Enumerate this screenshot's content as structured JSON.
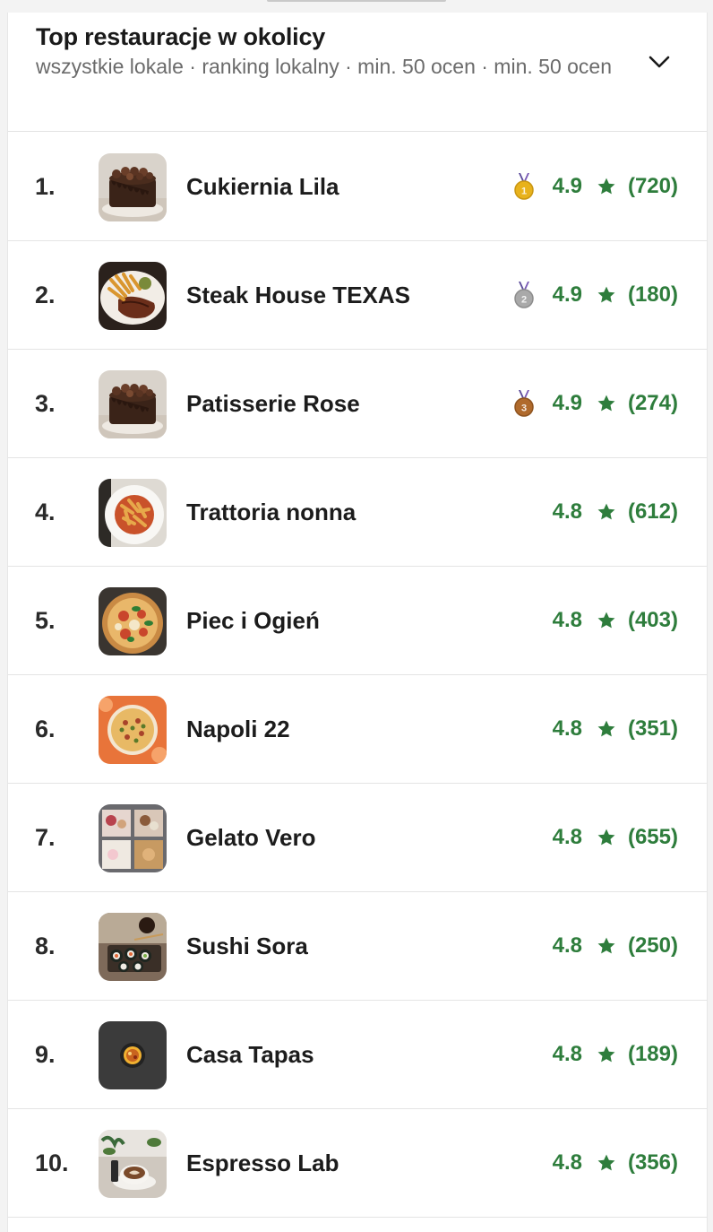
{
  "header": {
    "title": "Top restauracje w okolicy",
    "subtitle": "wszystkie lokale · ranking lokalny · min. 50 ocen · min. 50 ocen"
  },
  "colors": {
    "rating_green": "#2e7d3c",
    "gold": "#e8b21c",
    "silver": "#a9a9a9",
    "bronze": "#b06a2c"
  },
  "restaurants": [
    {
      "rank": "1.",
      "name": "Cukiernia Lila",
      "rating": "4.9",
      "count": "(720)",
      "medal": "gold",
      "thumb": "chocolate-cake"
    },
    {
      "rank": "2.",
      "name": "Steak House TEXAS",
      "rating": "4.9",
      "count": "(180)",
      "medal": "silver",
      "thumb": "steak-fries"
    },
    {
      "rank": "3.",
      "name": "Patisserie Rose",
      "rating": "4.9",
      "count": "(274)",
      "medal": "bronze",
      "thumb": "chocolate-cake"
    },
    {
      "rank": "4.",
      "name": "Trattoria nonna",
      "rating": "4.8",
      "count": "(612)",
      "medal": "",
      "thumb": "pasta"
    },
    {
      "rank": "5.",
      "name": "Piec i Ogień",
      "rating": "4.8",
      "count": "(403)",
      "medal": "",
      "thumb": "pizza-basil"
    },
    {
      "rank": "6.",
      "name": "Napoli 22",
      "rating": "4.8",
      "count": "(351)",
      "medal": "",
      "thumb": "pizza-orange"
    },
    {
      "rank": "7.",
      "name": "Gelato Vero",
      "rating": "4.8",
      "count": "(655)",
      "medal": "",
      "thumb": "gelato"
    },
    {
      "rank": "8.",
      "name": "Sushi Sora",
      "rating": "4.8",
      "count": "(250)",
      "medal": "",
      "thumb": "sushi"
    },
    {
      "rank": "9.",
      "name": "Casa Tapas",
      "rating": "4.8",
      "count": "(189)",
      "medal": "",
      "thumb": "tapas-dark"
    },
    {
      "rank": "10.",
      "name": "Espresso Lab",
      "rating": "4.8",
      "count": "(356)",
      "medal": "",
      "thumb": "coffee"
    }
  ]
}
